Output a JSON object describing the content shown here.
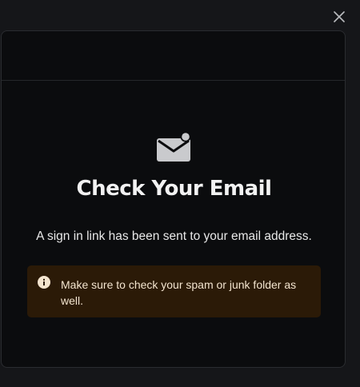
{
  "dialog": {
    "close_icon": "close-icon",
    "envelope_icon": "envelope-notification-icon",
    "title": "Check Your Email",
    "message": "A sign in link has been sent to your email address.",
    "notice": {
      "icon": "info-icon",
      "text": "Make sure to check your spam or junk folder as well."
    }
  },
  "colors": {
    "backdrop": "#151619",
    "modal_bg": "#0b0c0e",
    "notice_bg": "#2b1a07",
    "notice_text": "#f3e4cf",
    "title_text": "#f2f2f2"
  }
}
